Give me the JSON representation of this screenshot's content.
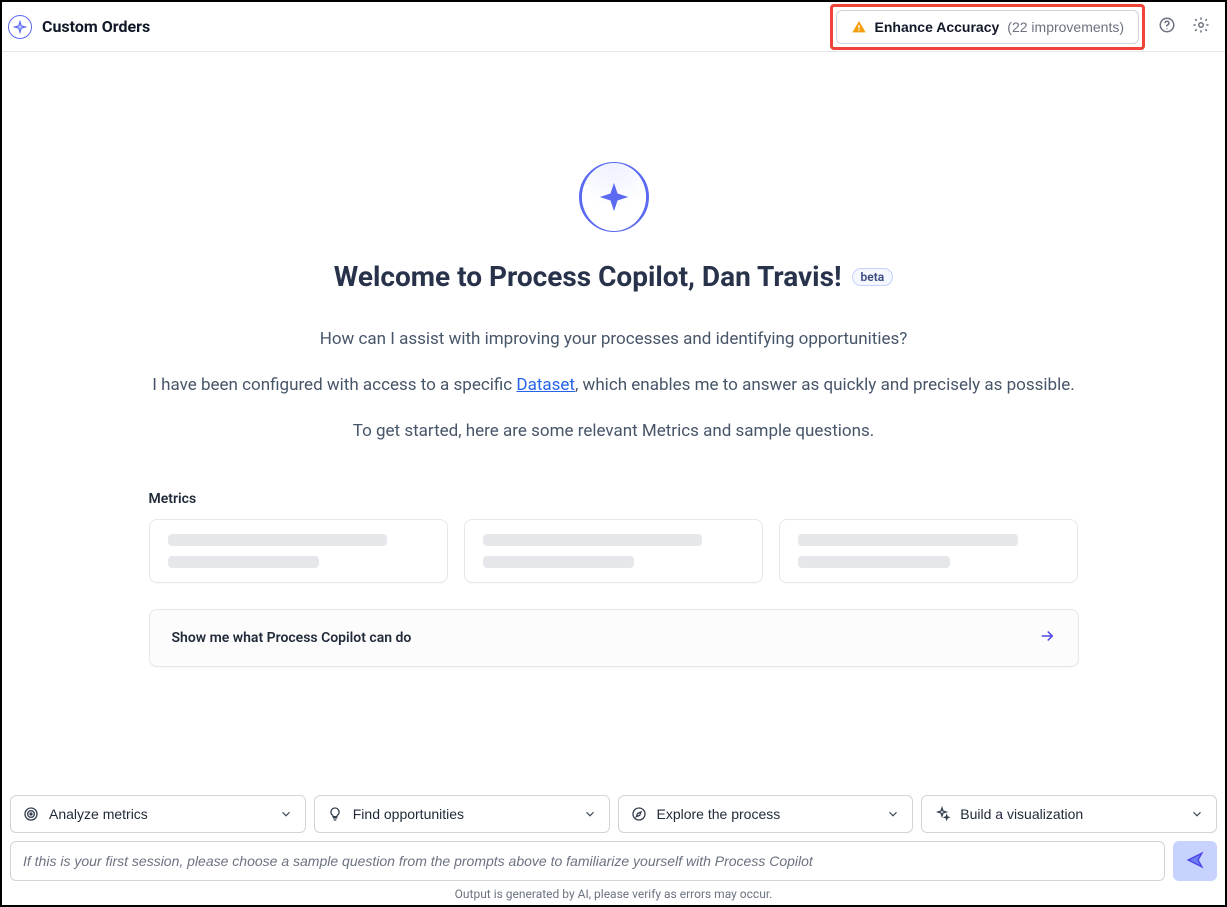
{
  "header": {
    "app_title": "Custom Orders",
    "enhance": {
      "label": "Enhance Accuracy",
      "count_text": "(22 improvements)"
    }
  },
  "welcome": {
    "heading": "Welcome to Process Copilot, Dan Travis!",
    "beta_label": "beta",
    "line1": "How can I assist with improving your processes and identifying opportunities?",
    "line2_prefix": "I have been configured with access to a specific ",
    "line2_link": "Dataset",
    "line2_suffix": ", which enables me to answer as quickly and precisely as possible.",
    "line3": "To get started, here are some relevant Metrics and sample questions."
  },
  "metrics": {
    "section_label": "Metrics",
    "show_me_label": "Show me what Process Copilot can do"
  },
  "prompts": {
    "analyze": "Analyze metrics",
    "opportunities": "Find opportunities",
    "explore": "Explore the process",
    "build": "Build a visualization"
  },
  "chat": {
    "placeholder": "If this is your first session, please choose a sample question from the prompts above to familiarize yourself with Process Copilot"
  },
  "footer": {
    "disclaimer": "Output is generated by AI, please verify as errors may occur."
  }
}
